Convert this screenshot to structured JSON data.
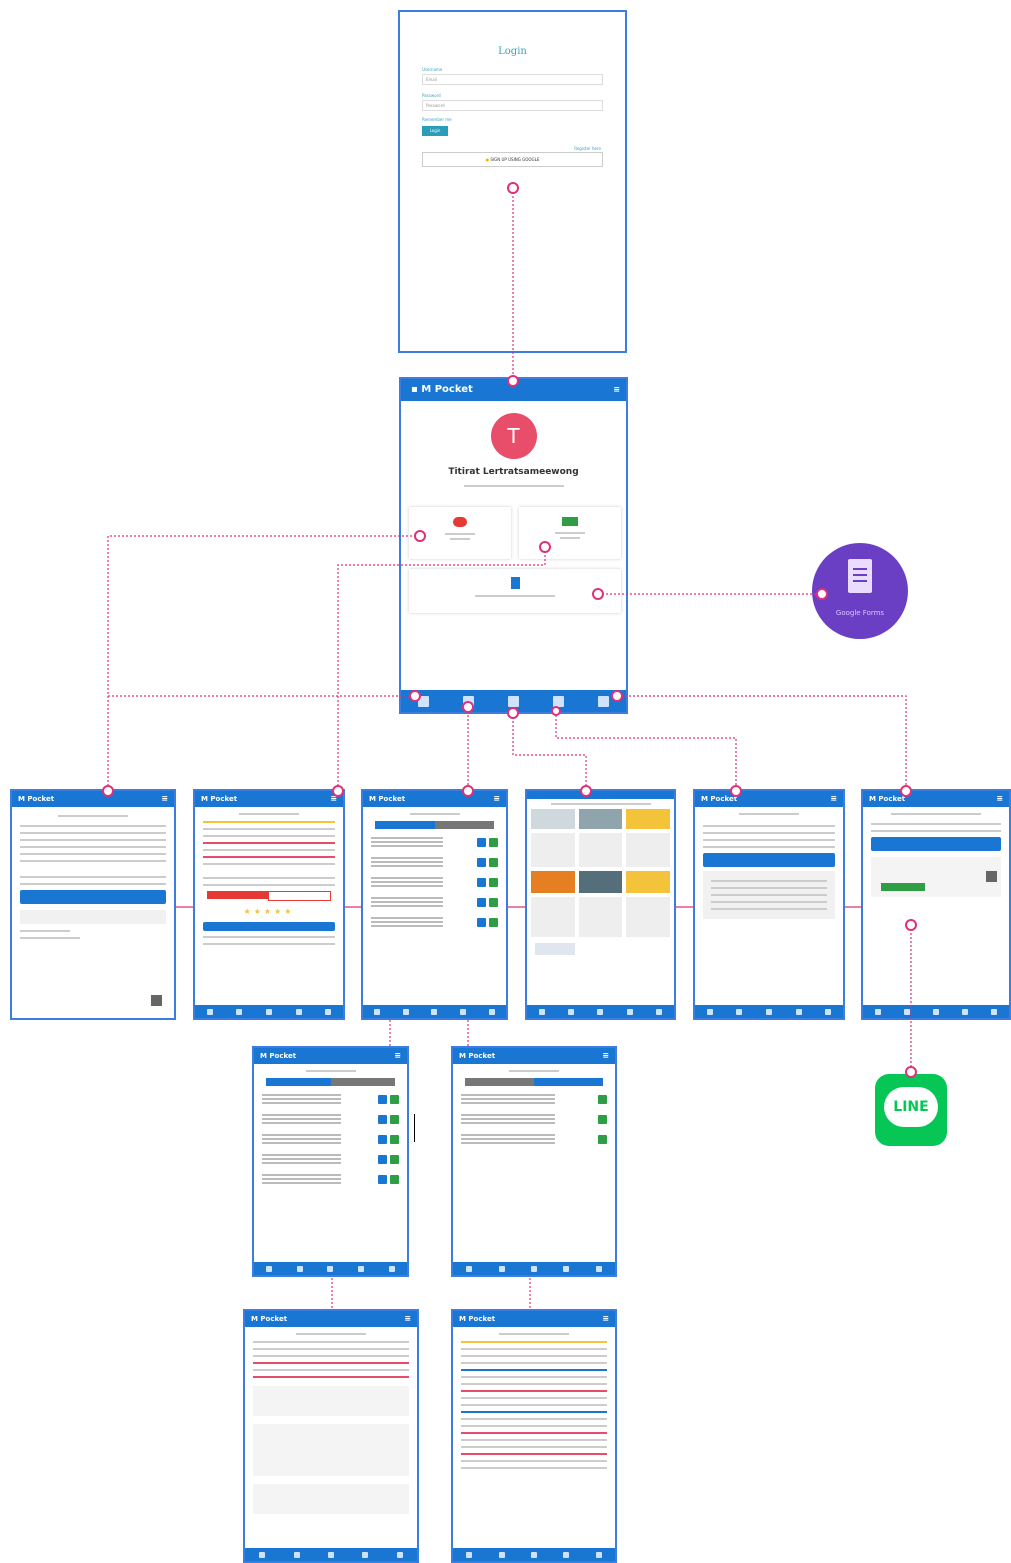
{
  "login": {
    "title": "Login",
    "username_label": "Username",
    "username_placeholder": "Email",
    "password_label": "Password",
    "password_placeholder": "Password",
    "remember_label": "Remember me",
    "login_button": "Login",
    "register_link": "Register here",
    "google_button": "SIGN UP USING GOOGLE"
  },
  "app": {
    "name": "M Pocket",
    "menu_icon": "hamburger-icon",
    "avatar_letter": "T",
    "user_name": "Titirat Lertratsameewong",
    "avatar_color": "#e84d6a",
    "bar_color": "#1976d2"
  },
  "home": {
    "tiles": [
      {
        "icon": "piggy-bank-icon",
        "color": "#e53935"
      },
      {
        "icon": "money-icon",
        "color": "#2e9d44"
      },
      {
        "icon": "document-icon",
        "color": "#1976d2"
      }
    ]
  },
  "external": {
    "google_forms_label": "Google Forms",
    "google_forms_color": "#6a3fc4",
    "line_label": "LINE",
    "line_color": "#06c755"
  },
  "colors": {
    "connector": "#e0307a"
  }
}
